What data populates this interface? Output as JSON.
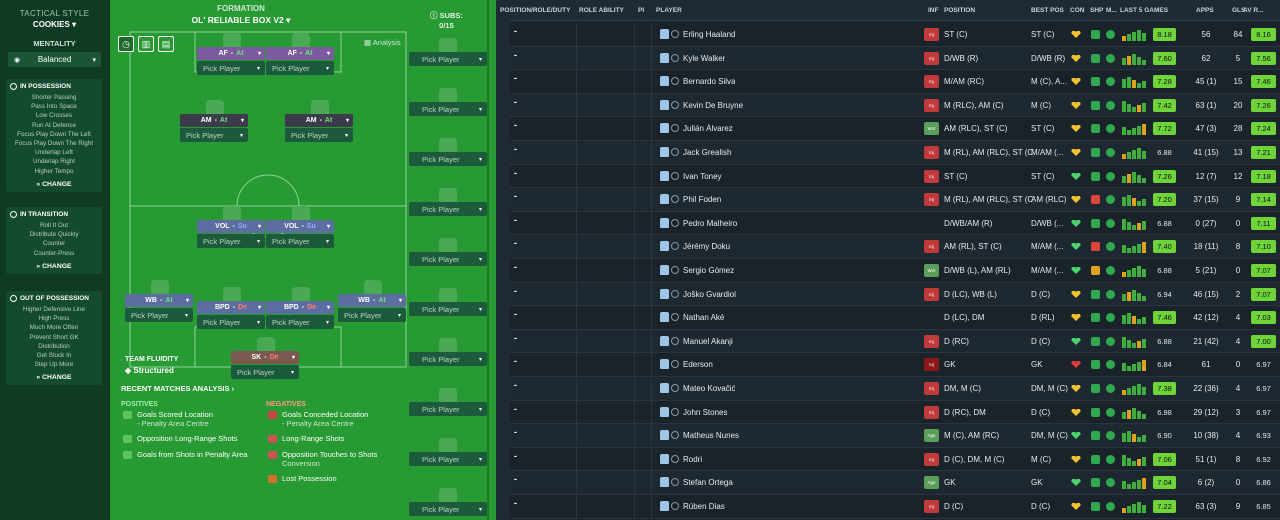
{
  "tactic": {
    "title_label": "TACTICAL STYLE",
    "name": "COOKIES",
    "mentality_label": "MENTALITY",
    "mentality": "Balanced",
    "boxes": [
      {
        "title": "IN POSSESSION",
        "items": [
          "Shorter Passing",
          "Pass Into Space",
          "Low Crosses",
          "Run At Defence",
          "Focus Play Down The Left",
          "Focus Play Down The Right",
          "Underlap Left",
          "Underlap Right",
          "Higher Tempo"
        ],
        "change": "CHANGE"
      },
      {
        "title": "IN TRANSITION",
        "items": [
          "Roll It Out",
          "Distribute Quickly",
          "Counter",
          "Counter-Press"
        ],
        "change": "CHANGE"
      },
      {
        "title": "OUT OF POSSESSION",
        "items": [
          "Higher Defensive Line",
          "High Press",
          "Much More Often",
          "Prevent Short GK",
          "Distribution",
          "Get Stuck In",
          "Step Up More"
        ],
        "change": "CHANGE"
      }
    ]
  },
  "formation": {
    "label": "FORMATION",
    "name": "OL' RELIABLE BOX V2",
    "analysis_label": "Analysis",
    "subs_label": "SUBS:",
    "subs_count": "0/15",
    "pick_label": "Pick Player",
    "positions": [
      {
        "role": "AF",
        "duty": "At",
        "duty_class": "at",
        "role_class": "r-at"
      },
      {
        "role": "AF",
        "duty": "At",
        "duty_class": "at",
        "role_class": "r-at"
      },
      {
        "role": "AM",
        "duty": "At",
        "duty_class": "at",
        "role_class": "r-am"
      },
      {
        "role": "AM",
        "duty": "At",
        "duty_class": "at",
        "role_class": "r-am"
      },
      {
        "role": "VOL",
        "duty": "Su",
        "duty_class": "su",
        "role_class": "r-su"
      },
      {
        "role": "VOL",
        "duty": "Su",
        "duty_class": "su",
        "role_class": "r-su"
      },
      {
        "role": "WB",
        "duty": "At",
        "duty_class": "at",
        "role_class": "r-su"
      },
      {
        "role": "BPD",
        "duty": "De",
        "duty_class": "de",
        "role_class": "r-su"
      },
      {
        "role": "BPD",
        "duty": "De",
        "duty_class": "de",
        "role_class": "r-su"
      },
      {
        "role": "WB",
        "duty": "At",
        "duty_class": "at",
        "role_class": "r-su"
      },
      {
        "role": "SK",
        "duty": "De",
        "duty_class": "de",
        "role_class": "r-gk"
      }
    ],
    "fluidity_label": "TEAM FLUIDITY",
    "fluidity": "Structured",
    "recent_label": "RECENT MATCHES ANALYSIS",
    "positives_label": "POSITIVES",
    "negatives_label": "NEGATIVES",
    "positives": [
      {
        "text": "Goals Scored Location",
        "sub": "- Penalty Area Centre"
      },
      {
        "text": "Opposition Long-Range Shots",
        "sub": ""
      },
      {
        "text": "Goals from Shots in Penalty Area",
        "sub": ""
      }
    ],
    "negatives": [
      {
        "text": "Goals Conceded Location",
        "sub": "- Penalty Area Centre"
      },
      {
        "text": "Long-Range Shots",
        "sub": ""
      },
      {
        "text": "Opposition Touches to Shots",
        "sub": "Conversion"
      },
      {
        "text": "Lost Possession",
        "sub": ""
      }
    ]
  },
  "table": {
    "headers": [
      "POSITION/ROLE/DUTY",
      "ROLE ABILITY",
      "PI",
      "PLAYER",
      "INF",
      "POSITION",
      "BEST POS",
      "CON",
      "SHP",
      "M...",
      "LAST 5 GAMES",
      "APPS",
      "GLS",
      "AV R..."
    ],
    "rows": [
      {
        "name": "Erling Haaland",
        "inf": "Inj",
        "inf_c": "red",
        "pos": "ST (C)",
        "best": "ST (C)",
        "rating": "8.18",
        "apps": "56",
        "gls": "84",
        "avr": "8.16",
        "avr_c": "g"
      },
      {
        "name": "Kyle Walker",
        "inf": "Inj",
        "inf_c": "red",
        "pos": "D/WB (R)",
        "best": "D/WB (R)",
        "rating": "7.60",
        "apps": "62",
        "gls": "5",
        "avr": "7.56",
        "avr_c": "g"
      },
      {
        "name": "Bernardo Silva",
        "inf": "Inj",
        "inf_c": "red",
        "pos": "M/AM (RC)",
        "best": "M (C), A...",
        "rating": "7.28",
        "apps": "45 (1)",
        "gls": "15",
        "avr": "7.46",
        "avr_c": "g"
      },
      {
        "name": "Kevin De Bruyne",
        "inf": "Inj",
        "inf_c": "red",
        "pos": "M (RLC), AM (C)",
        "best": "M (C)",
        "rating": "7.42",
        "apps": "63 (1)",
        "gls": "20",
        "avr": "7.26",
        "avr_c": "g"
      },
      {
        "name": "Julián Álvarez",
        "inf": "Wnt",
        "inf_c": "green",
        "pos": "AM (RLC), ST (C)",
        "best": "ST (C)",
        "rating": "7.72",
        "apps": "47 (3)",
        "gls": "28",
        "avr": "7.24",
        "avr_c": "g"
      },
      {
        "name": "Jack Grealish",
        "inf": "Inj",
        "inf_c": "red",
        "pos": "M (RL), AM (RLC), ST (C)",
        "best": "M/AM (...",
        "rating": "6.88",
        "apps": "41 (15)",
        "gls": "13",
        "avr": "7.21",
        "avr_c": "g"
      },
      {
        "name": "Ivan Toney",
        "inf": "Inj",
        "inf_c": "red",
        "pos": "ST (C)",
        "best": "ST (C)",
        "rating": "7.26",
        "apps": "12 (7)",
        "gls": "12",
        "avr": "7.18",
        "avr_c": "g"
      },
      {
        "name": "Phil Foden",
        "inf": "Inj",
        "inf_c": "red",
        "pos": "M (RL), AM (RLC), ST (C)",
        "best": "AM (RLC)",
        "rating": "7.20",
        "apps": "37 (15)",
        "gls": "9",
        "avr": "7.14",
        "avr_c": "g"
      },
      {
        "name": "Pedro Malheiro",
        "inf": "",
        "inf_c": "",
        "pos": "D/WB/AM (R)",
        "best": "D/WB (...",
        "rating": "6.88",
        "apps": "0 (27)",
        "gls": "0",
        "avr": "7.11",
        "avr_c": "g"
      },
      {
        "name": "Jérémy Doku",
        "inf": "Inj",
        "inf_c": "red",
        "pos": "AM (RL), ST (C)",
        "best": "M/AM (...",
        "rating": "7.40",
        "apps": "18 (11)",
        "gls": "8",
        "avr": "7.10",
        "avr_c": "g"
      },
      {
        "name": "Sergio Gómez",
        "inf": "Wnt",
        "inf_c": "green",
        "pos": "D/WB (L), AM (RL)",
        "best": "M/AM (...",
        "rating": "6.88",
        "apps": "5 (21)",
        "gls": "0",
        "avr": "7.07",
        "avr_c": "g"
      },
      {
        "name": "Joško Gvardiol",
        "inf": "Inj",
        "inf_c": "red",
        "pos": "D (LC), WB (L)",
        "best": "D (C)",
        "rating": "6.94",
        "apps": "46 (15)",
        "gls": "2",
        "avr": "7.07",
        "avr_c": "g"
      },
      {
        "name": "Nathan Aké",
        "inf": "",
        "inf_c": "",
        "pos": "D (LC), DM",
        "best": "D (RL)",
        "rating": "7.46",
        "apps": "42 (12)",
        "gls": "4",
        "avr": "7.03",
        "avr_c": "g"
      },
      {
        "name": "Manuel Akanji",
        "inf": "Inj",
        "inf_c": "red",
        "pos": "D (RC)",
        "best": "D (C)",
        "rating": "6.88",
        "apps": "21 (42)",
        "gls": "4",
        "avr": "7.00",
        "avr_c": "g"
      },
      {
        "name": "Ederson",
        "inf": "Inj",
        "inf_c": "dark",
        "pos": "GK",
        "best": "GK",
        "rating": "6.84",
        "apps": "61",
        "gls": "0",
        "avr": "6.97",
        "avr_c": "n"
      },
      {
        "name": "Mateo Kovačić",
        "inf": "Inj",
        "inf_c": "red",
        "pos": "DM, M (C)",
        "best": "DM, M (C)",
        "rating": "7.38",
        "apps": "22 (36)",
        "gls": "4",
        "avr": "6.97",
        "avr_c": "n"
      },
      {
        "name": "John Stones",
        "inf": "Inj",
        "inf_c": "red",
        "pos": "D (RC), DM",
        "best": "D (C)",
        "rating": "6.98",
        "apps": "29 (12)",
        "gls": "3",
        "avr": "6.97",
        "avr_c": "n"
      },
      {
        "name": "Matheus Nunes",
        "inf": "Agn",
        "inf_c": "green",
        "pos": "M (C), AM (RC)",
        "best": "DM, M (C)",
        "rating": "6.90",
        "apps": "10 (38)",
        "gls": "4",
        "avr": "6.93",
        "avr_c": "n"
      },
      {
        "name": "Rodri",
        "inf": "Inj",
        "inf_c": "red",
        "pos": "D (C), DM, M (C)",
        "best": "M (C)",
        "rating": "7.06",
        "apps": "51 (1)",
        "gls": "8",
        "avr": "6.92",
        "avr_c": "n"
      },
      {
        "name": "Stefan Ortega",
        "inf": "Agn",
        "inf_c": "green",
        "pos": "GK",
        "best": "GK",
        "rating": "7.04",
        "apps": "6 (2)",
        "gls": "0",
        "avr": "6.86",
        "avr_c": "n"
      },
      {
        "name": "Rúben Dias",
        "inf": "Inj",
        "inf_c": "red",
        "pos": "D (C)",
        "best": "D (C)",
        "rating": "7.22",
        "apps": "63 (3)",
        "gls": "9",
        "avr": "6.85",
        "avr_c": "n"
      }
    ]
  }
}
